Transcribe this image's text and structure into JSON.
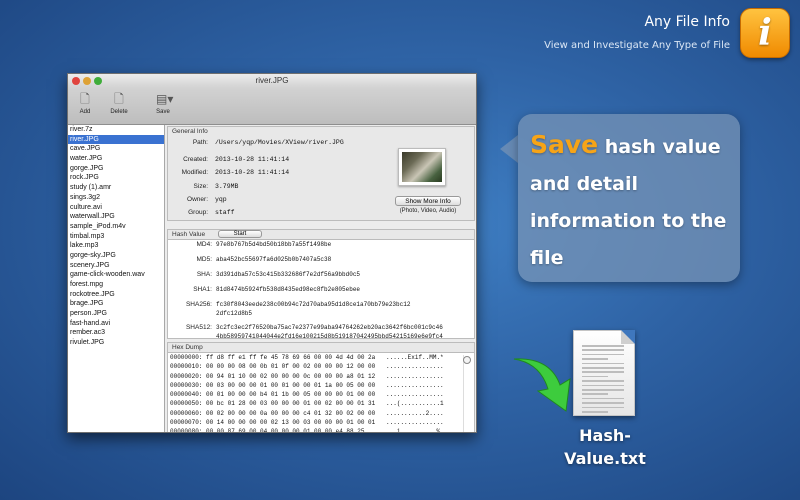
{
  "brand": {
    "title": "Any File Info",
    "subtitle": "View and Investigate Any Type of File",
    "icon_letter": "i"
  },
  "window": {
    "title": "river.JPG"
  },
  "toolbar": {
    "add_label": "Add",
    "delete_label": "Delete",
    "save_label": "Save"
  },
  "files": [
    "river.7z",
    "river.JPG",
    "cave.JPG",
    "water.JPG",
    "gorge.JPG",
    "rock.JPG",
    "study (1).amr",
    "sings.3g2",
    "culture.avi",
    "waterwall.JPG",
    "sample_iPod.m4v",
    "timbal.mp3",
    "lake.mp3",
    "gorge-sky.JPG",
    "scenery.JPG",
    "game-click-wooden.wav",
    "forest.mpg",
    "rockotree.JPG",
    "brage.JPG",
    "person.JPG",
    "fast-hand.avi",
    "rember.ac3",
    "rivulet.JPG"
  ],
  "selected_file": "river.JPG",
  "general": {
    "title": "General Info",
    "path_label": "Path:",
    "path": "/Users/yqp/Movies/XView/river.JPG",
    "created_label": "Created:",
    "created": "2013-10-28 11:41:14",
    "modified_label": "Modified:",
    "modified": "2013-10-28 11:41:14",
    "size_label": "Size:",
    "size": "3.79MB",
    "owner_label": "Owner:",
    "owner": "yqp",
    "group_label": "Group:",
    "group": "staff",
    "more_button": "Show More Info",
    "more_sub": "(Photo, Video, Audio)"
  },
  "hash": {
    "title": "Hash Value",
    "start_button": "Start",
    "md4_label": "MD4:",
    "md4": "97e8b767b5d4bd50b18bb7a55f1498be",
    "md5_label": "MD5:",
    "md5": "aba452bc55697fa6d025b0b7407a5c38",
    "sha_label": "SHA:",
    "sha": "3d391dba57c53c415b332686f7e2df56a9bbd0c5",
    "sha1_label": "SHA1:",
    "sha1": "81d8474b5924fb538d8435ed98ec8fb2e805ebee",
    "sha256_label": "SHA256:",
    "sha256_1": "fc30f8043eede238c00b94c72d70aba95d1d8ce1a70bb79e23bc12",
    "sha256_2": "2dfc12d8b5",
    "sha512_label": "SHA512:",
    "sha512_1": "3c2fc3ec2f76520ba75ac7e2377e99aba94764262eb20ac3642f6bc001c9c46",
    "sha512_2": "4bb58959741044044e2fd16e100215d8b519187042495bbd54215169e6e9fc4"
  },
  "hexdump": {
    "title": "Hex Dump",
    "lines": [
      "00000000: ff d8 ff e1 ff fe 45 78 69 66 00 00 4d 4d 00 2a   ......Exif..MM.*",
      "00000010: 00 00 00 08 00 0b 01 0f 00 02 00 00 00 12 00 00   ................",
      "00000020: 00 94 01 10 00 02 00 00 00 0c 00 00 00 a8 01 12   ................",
      "00000030: 00 03 00 00 00 01 00 01 00 00 01 1a 00 05 00 00   ................",
      "00000040: 00 01 00 00 00 b4 01 1b 00 05 00 00 00 01 00 00   ................",
      "00000050: 00 bc 01 28 00 03 00 00 00 01 00 02 00 00 01 31   ...(...........1",
      "00000060: 00 02 00 00 00 0a 00 00 00 c4 01 32 00 02 00 00   ...........2....",
      "00000070: 00 14 00 00 00 00 02 13 00 03 00 00 00 01 00 01   ................",
      "00000080: 00 00 87 69 00 04 00 00 00 01 00 00 e4 88 25      ...i..........%"
    ]
  },
  "callout": {
    "highlight": "Save",
    "rest": " hash value and detail information to the file"
  },
  "doc_caption": "Hash-Value.txt",
  "colors": {
    "accent": "#f7a417",
    "selection": "#3a72d1",
    "arrow": "#3dcc3d"
  }
}
